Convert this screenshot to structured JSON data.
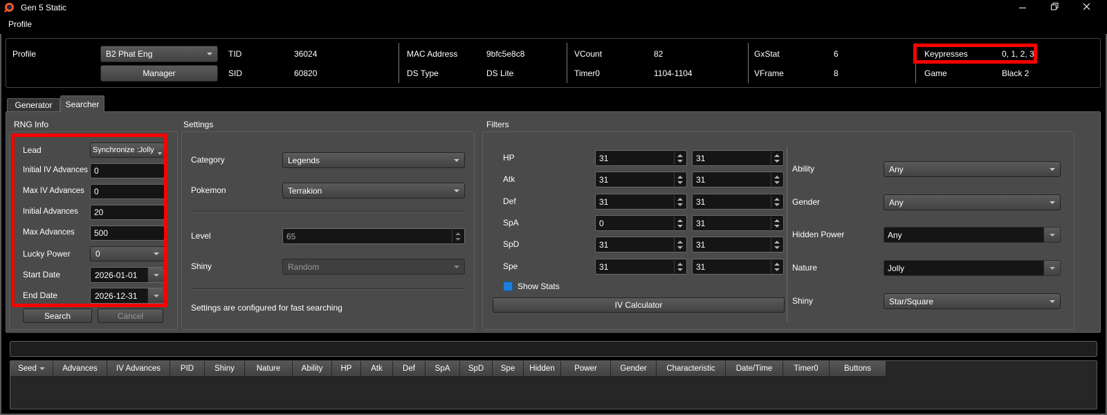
{
  "window": {
    "title": "Gen 5 Static"
  },
  "menubar": {
    "profile": "Profile"
  },
  "icons": {
    "app_logo": "pokefinder-swirl",
    "minimize": "minimize",
    "restore": "restore",
    "close": "close",
    "combo_arrow": "chevron-down",
    "seed_sort": "sort-indicator-down"
  },
  "colors": {
    "highlight": "#ff0000",
    "checkbox_checked": "#1b80d8",
    "logo_accent": "#ef5a21"
  },
  "profile_box": {
    "profile_label": "Profile",
    "profile_value": "B2 Phat Eng",
    "manager_button": "Manager",
    "stats": [
      {
        "label": "TID",
        "value": "36024"
      },
      {
        "label": "SID",
        "value": "60820"
      },
      {
        "label": "MAC Address",
        "value": "9bfc5e8c8"
      },
      {
        "label": "DS Type",
        "value": "DS Lite"
      },
      {
        "label": "VCount",
        "value": "82"
      },
      {
        "label": "Timer0",
        "value": "1104-1104"
      },
      {
        "label": "GxStat",
        "value": "6"
      },
      {
        "label": "VFrame",
        "value": "8"
      },
      {
        "label": "Keypresses",
        "value": "0, 1, 2, 3"
      },
      {
        "label": "Game",
        "value": "Black 2"
      }
    ]
  },
  "tabs": {
    "generator": "Generator",
    "searcher": "Searcher"
  },
  "rng_info": {
    "title": "RNG Info",
    "lead": {
      "label": "Lead",
      "value": "Synchronize :Jolly"
    },
    "fields": [
      {
        "label": "Initial IV Advances",
        "value": "0"
      },
      {
        "label": "Max IV Advances",
        "value": "0"
      },
      {
        "label": "Initial Advances",
        "value": "20"
      },
      {
        "label": "Max Advances",
        "value": "500"
      }
    ],
    "lucky_power": {
      "label": "Lucky Power",
      "value": "0"
    },
    "start_date": {
      "label": "Start Date",
      "value": "2026-01-01"
    },
    "end_date": {
      "label": "End Date",
      "value": "2026-12-31"
    },
    "search_button": "Search",
    "cancel_button": "Cancel"
  },
  "settings": {
    "title": "Settings",
    "category": {
      "label": "Category",
      "value": "Legends"
    },
    "pokemon": {
      "label": "Pokemon",
      "value": "Terrakion"
    },
    "level": {
      "label": "Level",
      "value": "65"
    },
    "shiny": {
      "label": "Shiny",
      "value": "Random"
    },
    "note": "Settings are configured for fast searching"
  },
  "filters": {
    "title": "Filters",
    "ivs": [
      {
        "label": "HP",
        "min": "31",
        "max": "31"
      },
      {
        "label": "Atk",
        "min": "31",
        "max": "31"
      },
      {
        "label": "Def",
        "min": "31",
        "max": "31"
      },
      {
        "label": "SpA",
        "min": "0",
        "max": "31"
      },
      {
        "label": "SpD",
        "min": "31",
        "max": "31"
      },
      {
        "label": "Spe",
        "min": "31",
        "max": "31"
      }
    ],
    "show_stats": "Show Stats",
    "iv_calculator_button": "IV Calculator",
    "ability": {
      "label": "Ability",
      "value": "Any"
    },
    "gender": {
      "label": "Gender",
      "value": "Any"
    },
    "hidden_power": {
      "label": "Hidden Power",
      "value": "Any"
    },
    "nature": {
      "label": "Nature",
      "value": "Jolly"
    },
    "shiny": {
      "label": "Shiny",
      "value": "Star/Square"
    }
  },
  "results_table": {
    "columns": [
      "Seed",
      "Advances",
      "IV Advances",
      "PID",
      "Shiny",
      "Nature",
      "Ability",
      "HP",
      "Atk",
      "Def",
      "SpA",
      "SpD",
      "Spe",
      "Hidden",
      "Power",
      "Gender",
      "Characteristic",
      "Date/Time",
      "Timer0",
      "Buttons"
    ]
  }
}
